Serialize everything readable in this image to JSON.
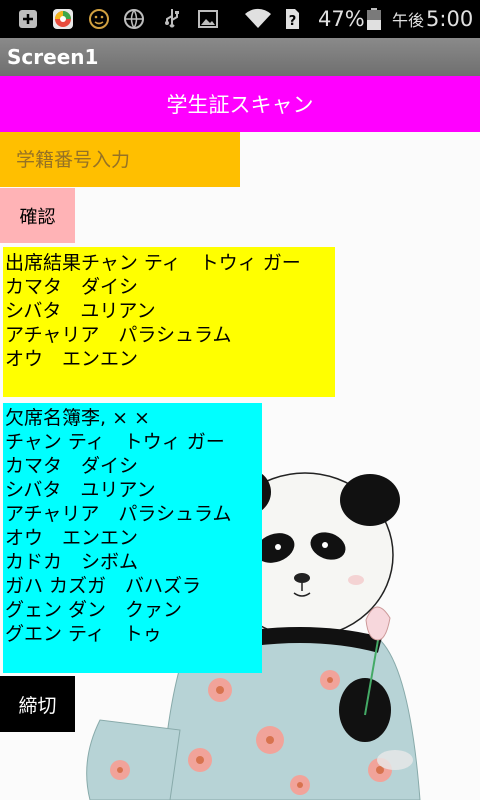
{
  "statusbar": {
    "icons": [
      "add-box-icon",
      "app-icon",
      "face-icon",
      "globe-icon",
      "usb-icon",
      "image-icon",
      "wifi-icon",
      "sim-unknown-icon",
      "battery-icon"
    ],
    "battery_percent": "47%",
    "clock_ampm": "午後",
    "clock_time": "5:00"
  },
  "titlebar": {
    "title": "Screen1"
  },
  "main": {
    "scan_button_label": "学生証スキャン",
    "id_input_value": "",
    "id_input_placeholder": "学籍番号入力",
    "confirm_button_label": "確認",
    "attendance_title": "出席結果",
    "attendance_lines": [
      "チャン ティ　トウィ ガー",
      "カマタ　ダイシ",
      "シバタ　ユリアン",
      "アチャリア　パラシュラム",
      "オウ　エンエン"
    ],
    "absence_title": "欠席名簿",
    "absence_header": "李, × ×",
    "absence_lines": [
      "チャン ティ　トウィ ガー",
      "カマタ　ダイシ",
      "シバタ　ユリアン",
      "アチャリア　パラシュラム",
      "オウ　エンエン",
      "カドカ　シボム",
      "ガハ カズガ　バハズラ",
      "グェン ダン　クァン",
      "グエン ティ　トゥ"
    ],
    "close_button_label": "締切"
  },
  "colors": {
    "scan_button": "#ff00ff",
    "id_input": "#ffbf00",
    "confirm_button": "#ffb3b6",
    "attendance_box": "#ffff00",
    "absence_box": "#00ffff",
    "close_button": "#000000",
    "titlebar": "#7a7a7a"
  },
  "background": {
    "image": "panda-illustration"
  }
}
